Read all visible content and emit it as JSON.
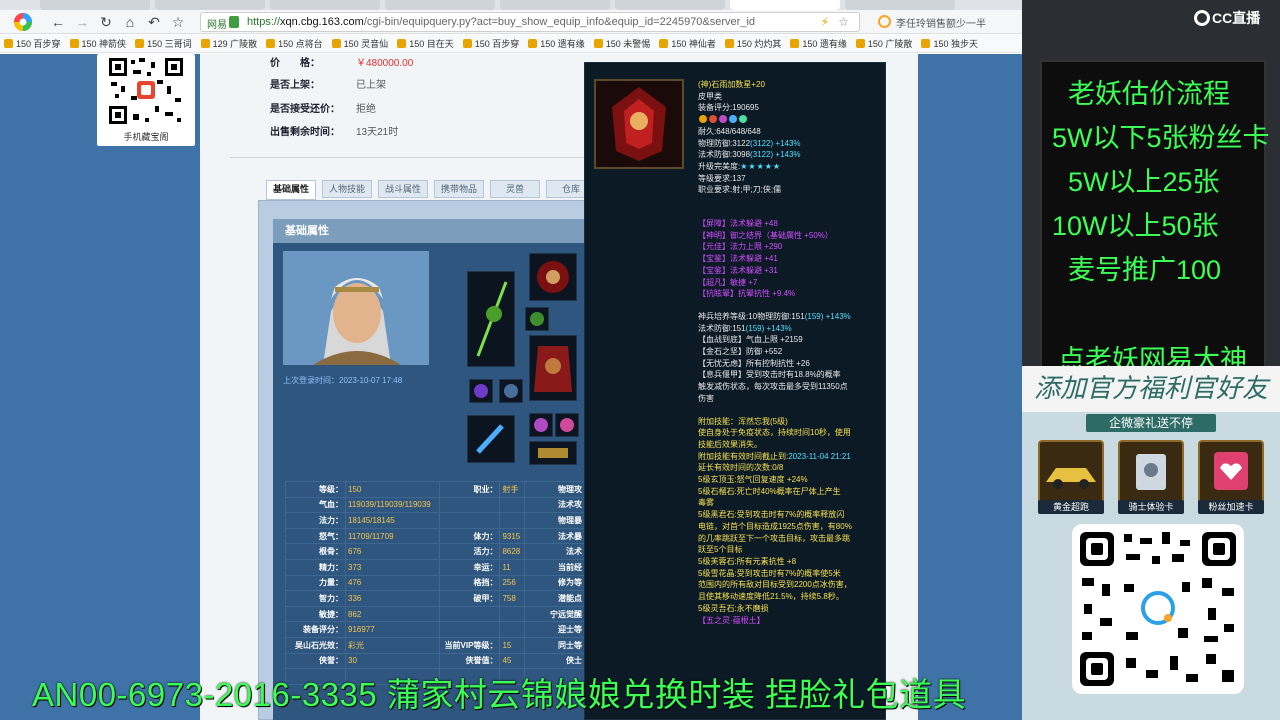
{
  "browser": {
    "address": {
      "badge": "网易",
      "url_prefix": "https://",
      "url_host": "xqn.cbg.163.com",
      "url_path": "/cgi-bin/equipquery.py?act=buy_show_equip_info&equip_id=2245970&server_id"
    },
    "search_text": "李任玲销售额少一半",
    "bookmarks": [
      "150 百步穿",
      "150 神箭侠",
      "150 三哥词",
      "129 广陵散",
      "150 点将台",
      "150 灵音仙",
      "150 目在天",
      "150 百步穿",
      "150 遗有缘",
      "150 未警惕",
      "150 神仙者",
      "150 灼灼其",
      "150 遗有缘",
      "150 广陵散",
      "150 独步天"
    ]
  },
  "page": {
    "qr_caption": "手机藏宝阁",
    "price_label": "价　　格：",
    "price_value": "￥480000.00",
    "listed_label": "是否上架：",
    "listed_value": "已上架",
    "bargain_label": "是否接受还价：",
    "bargain_value": "拒绝",
    "remaining_label": "出售剩余时间：",
    "remaining_value": "13天21时",
    "tabs": [
      "基础属性",
      "人物技能",
      "战斗属性",
      "携带物品",
      "灵兽",
      "仓库"
    ],
    "panel_title": "基础属性",
    "last_online": "上次登录时间：2023-10-07 17:48",
    "stats": [
      [
        "等级：",
        "150",
        "职业：",
        "射手",
        "物理攻"
      ],
      [
        "气血：",
        "119039/119039/119039",
        "",
        "",
        "法术攻"
      ],
      [
        "法力：",
        "18145/18145",
        "",
        "",
        "物理暴"
      ],
      [
        "怒气：",
        "11709/11709",
        "体力：",
        "9315",
        "法术暴"
      ],
      [
        "根骨：",
        "676",
        "活力：",
        "8628",
        "法术"
      ],
      [
        "精力：",
        "373",
        "幸运：",
        "11",
        "当前经"
      ],
      [
        "力量：",
        "476",
        "格挡：",
        "256",
        "修为等"
      ],
      [
        "智力：",
        "336",
        "破甲：",
        "758",
        "潜能点"
      ],
      [
        "敏捷：",
        "862",
        "",
        "",
        "宁远觉醒"
      ],
      [
        "装备评分：",
        "916977",
        "",
        "",
        "迎士等"
      ],
      [
        "吴山石光效：",
        "彩光",
        "当前VIP等级：",
        "15",
        "同士等"
      ],
      [
        "侠誉：",
        "30",
        "侠誉值：",
        "45",
        "侠士"
      ],
      [
        "",
        "",
        "",
        "",
        ""
      ]
    ],
    "stats_extra": {
      "xiayu_a": "30",
      "xiayu_b": "45"
    }
  },
  "tooltip": {
    "name": "(神)石雨加数星+20",
    "type": "皮甲类",
    "score": "装备评分:190695",
    "durability": "耐久:648/648/648",
    "phys_def": "物理防御:3122",
    "phys_def_paren": "(3122)",
    "phys_def_plus": "+143%",
    "mag_def": "法术防御:3098",
    "mag_def_paren": "(3122)",
    "mag_def_plus": "+143%",
    "upgrade_label": "升级完美度:",
    "stars": "★★★★★",
    "level_req": "等级要求:137",
    "class_req": "职业要求:射;甲;刀;侠;儒",
    "purple_lines": [
      "【屏障】法术躲避 +48",
      "【神明】御之结界（基础属性 +50%）",
      "【元佳】法力上限 +290",
      "【宝鉴】法术躲避 +41",
      "【宝鉴】法术躲避 +31",
      "【超凡】敏捷 +7",
      "【抗眩晕】抗晕抗性 +9.4%"
    ],
    "rune_line_a": "神兵培养等级:10物理防御:151",
    "rune_line_a_paren": "(159)",
    "rune_line_a_plus": "+143%",
    "rune_line_b": "法术防御:151",
    "rune_line_b_paren": "(159)",
    "rune_line_b_plus": "+143%",
    "white_lines": [
      "【血战到底】气血上限 +2159",
      "【金石之坚】防御 +552",
      "【无忧无虑】所有控制抗性 +26",
      "【息兵偃甲】受到攻击时有18.8%的概率",
      "触发减伤状态，每次攻击最多受到11350点",
      "伤害"
    ],
    "skill_title": "附加技能：浑然忘我(5级)",
    "skill_desc_1": "使自身处于免疫状态，持续时间10秒，使用",
    "skill_desc_2": "技能后效果消失。",
    "skill_expire": "附加技能有效时间截止到:",
    "skill_expire_date": "2023-11-04 21:21",
    "skill_extend": "延长有效时间的次数:0/8",
    "yellow_lines": [
      "5级玄顶玉:怒气回复速度 +24%",
      "5级石榴石:死亡时40%概率在尸体上产生",
      "毒雾",
      "5级黑君石:受到攻击时有7%的概率释放闪",
      "电链，对首个目标造成1925点伤害，有80%",
      "的几率跳跃至下一个攻击目标，攻击最多跳",
      "跃至5个目标",
      "5级芙蓉石:所有元素抗性 +8",
      "5级雪花晶:受到攻击时有7%的概率使5米",
      "范围内的所有敌对目标受到2200点冰伤害，",
      "且使其移动速度降低21.5%，持续5.8秒。",
      "5级灵吾石:永不磨损"
    ],
    "set_name": "【五之灵·蕴根土】"
  },
  "stream": {
    "logo": "CC直播",
    "board": [
      "老妖估价流程",
      "5W以下5张粉丝卡",
      "5W以上25张",
      "10W以上50张",
      "麦号推广100",
      "点老妖网易大神"
    ],
    "promo_title": "添加官方福利官好友",
    "promo_sub": "企微豪礼送不停",
    "gifts": [
      "黄金超跑",
      "骑士体验卡",
      "粉丝加速卡"
    ]
  },
  "overlay_text": "AN00-6973-2016-3335 蒲家村云锦娘娘兑换时装 捏脸礼包道具",
  "colors": {
    "accent_green": "#3cff56",
    "price_red": "#e03030",
    "page_blue": "#3f73a7"
  }
}
